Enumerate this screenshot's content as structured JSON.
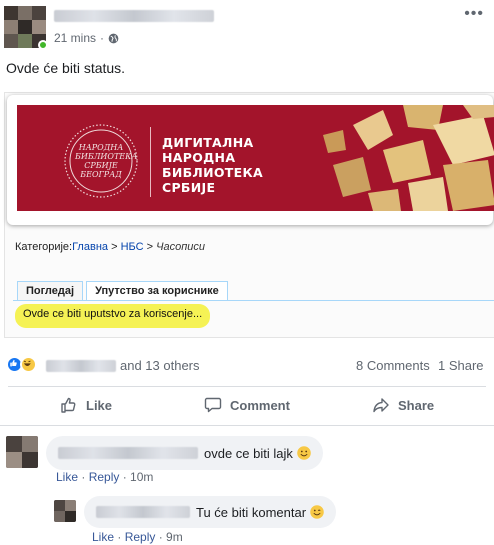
{
  "post": {
    "timestamp": "21 mins",
    "status_text": "Ovde će biti status."
  },
  "embed": {
    "banner_title_lines": [
      "ДИГИТАЛНА",
      "НАРОДНА",
      "БИБЛИОТЕКА",
      "СРБИЈЕ"
    ],
    "seal_lines": [
      "НАРОДНА",
      "БИБЛИОТЕКА",
      "СРБИЈЕ",
      "БЕОГРАД"
    ],
    "breadcrumb": {
      "prefix": "Категорије:",
      "item1": "Главна",
      "sep": " > ",
      "item2": "НБС",
      "item3": "Часописи"
    },
    "tabs": [
      "Погледај",
      "Упутство за кориснике"
    ],
    "instructions_text": "Ovde ce biti uputstvo za koriscenje..."
  },
  "reactions": {
    "others_text": "and 13 others",
    "comments_count": "8 Comments",
    "shares_count": "1 Share"
  },
  "actions": {
    "like": "Like",
    "comment": "Comment",
    "share": "Share"
  },
  "comments": [
    {
      "text": "ovde ce biti lajk",
      "like": "Like",
      "reply": "Reply",
      "time": "10m"
    },
    {
      "text": "Tu će biti komentar",
      "like": "Like",
      "reply": "Reply",
      "time": "9m"
    }
  ],
  "icons": {
    "globe": "globe-icon",
    "more": "more-options-icon",
    "like_reaction": "like-reaction-icon",
    "haha_reaction": "haha-reaction-icon",
    "thumbs_up": "thumbs-up-icon",
    "comment": "comment-icon",
    "share": "share-arrow-icon",
    "smile_emoji": "smile-emoji-icon",
    "wink_emoji": "wink-emoji-icon"
  },
  "colors": {
    "facebook_blue": "#1877f2",
    "banner_red": "#a3142b",
    "highlight_yellow": "#f5f255",
    "meta_gray": "#606770",
    "link_blue": "#385898"
  }
}
